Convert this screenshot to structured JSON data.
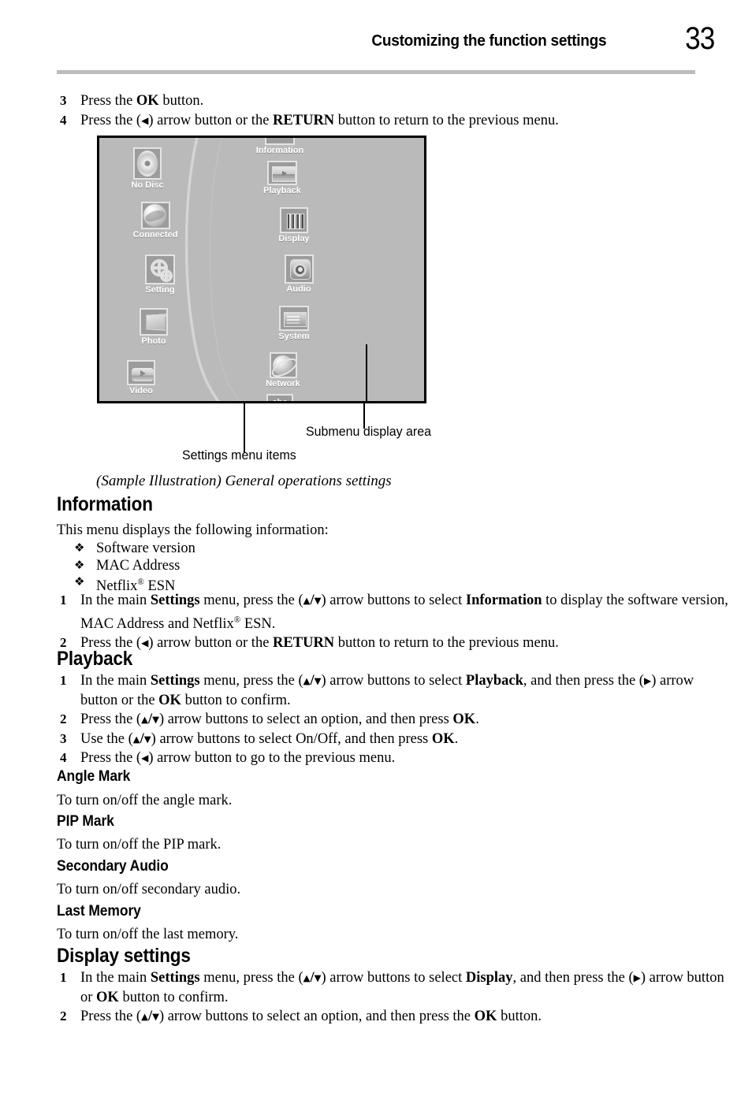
{
  "header": {
    "title": "Customizing the function settings",
    "page_number": "33"
  },
  "top_steps": [
    {
      "num": "3",
      "html": "Press the <b>OK</b> button."
    },
    {
      "num": "4",
      "html": "Press the (<span class=\"arw arw-lr\">&#9664;</span>) arrow button or the <b>RETURN</b> button to return to the previous menu."
    }
  ],
  "illustration": {
    "left_menu": [
      {
        "label": "No Disc",
        "icon": "disc-icon"
      },
      {
        "label": "Connected",
        "icon": "globe-icon"
      },
      {
        "label": "Setting",
        "icon": "gears-icon"
      },
      {
        "label": "Photo",
        "icon": "photo-icon"
      },
      {
        "label": "Video",
        "icon": "video-icon"
      }
    ],
    "right_menu": [
      {
        "label": "Information",
        "icon": "information-icon"
      },
      {
        "label": "Playback",
        "icon": "playback-icon"
      },
      {
        "label": "Display",
        "icon": "display-icon"
      },
      {
        "label": "Audio",
        "icon": "audio-icon"
      },
      {
        "label": "System",
        "icon": "system-icon"
      },
      {
        "label": "Network",
        "icon": "network-icon"
      },
      {
        "label": "abc",
        "icon": "abc-icon"
      }
    ],
    "callouts": {
      "settings_menu_items": "Settings menu items",
      "submenu_display_area": "Submenu display area"
    },
    "caption": "(Sample Illustration) General operations settings"
  },
  "information": {
    "heading": "Information",
    "intro": "This menu displays the following information:",
    "bullets": [
      {
        "glyph": "❖",
        "html": "Software version"
      },
      {
        "glyph": "❖",
        "html": "MAC Address"
      },
      {
        "glyph": "❖",
        "html": "Netflix<sup>&#174;</sup> ESN"
      }
    ],
    "steps": [
      {
        "num": "1",
        "html": "In the main <b>Settings</b> menu, press the (<span class=\"arw\">&#9650;</span><b>/</b><span class=\"arw\">&#9660;</span>) arrow buttons to select <b>Information</b> to display the software version, MAC Address and Netflix<sup>&#174;</sup> ESN."
      },
      {
        "num": "2",
        "html": "Press the (<span class=\"arw arw-lr\">&#9664;</span>) arrow button or the <b>RETURN</b> button to return to the previous menu."
      }
    ]
  },
  "playback": {
    "heading": "Playback",
    "steps": [
      {
        "num": "1",
        "html": "In the main <b>Settings</b> menu, press the (<span class=\"arw\">&#9650;</span><b>/</b><span class=\"arw\">&#9660;</span>) arrow buttons to select <b>Playback</b>, and then press the (<span class=\"arw arw-lr\">&#9654;</span>) arrow button or the <b>OK</b> button to confirm."
      },
      {
        "num": "2",
        "html": "Press the (<span class=\"arw\">&#9650;</span><b>/</b><span class=\"arw\">&#9660;</span>) arrow buttons to select an option, and then press <b>OK</b>."
      },
      {
        "num": "3",
        "html": "Use the (<span class=\"arw\">&#9650;</span><b>/</b><span class=\"arw\">&#9660;</span>) arrow buttons to select On/Off, and then press <b>OK</b>."
      },
      {
        "num": "4",
        "html": "Press the (<span class=\"arw arw-lr\">&#9664;</span>) arrow button to go to the previous menu."
      }
    ],
    "subsections": [
      {
        "heading": "Angle Mark",
        "body": "To turn on/off the angle mark."
      },
      {
        "heading": "PIP Mark",
        "body": "To turn on/off the PIP mark."
      },
      {
        "heading": "Secondary Audio",
        "body": "To turn on/off secondary audio."
      },
      {
        "heading": "Last Memory",
        "body": "To turn on/off the last memory."
      }
    ]
  },
  "display_settings": {
    "heading": "Display settings",
    "steps": [
      {
        "num": "1",
        "html": "In the main <b>Settings</b> menu, press the (<span class=\"arw\">&#9650;</span><b>/</b><span class=\"arw\">&#9660;</span>) arrow buttons to select <b>Display</b>, and then press the (<span class=\"arw arw-lr\">&#9654;</span>) arrow button or <b>OK</b> button to confirm."
      },
      {
        "num": "2",
        "html": "Press the (<span class=\"arw\">&#9650;</span><b>/</b><span class=\"arw\">&#9660;</span>) arrow buttons to select an option, and then press the <b>OK</b> button."
      }
    ]
  },
  "colors": {
    "screen_bg": "#bababa",
    "icon_bg": "#9c9c9c",
    "icon_border": "#e4e4e4",
    "rule": "#bcbcbc"
  }
}
